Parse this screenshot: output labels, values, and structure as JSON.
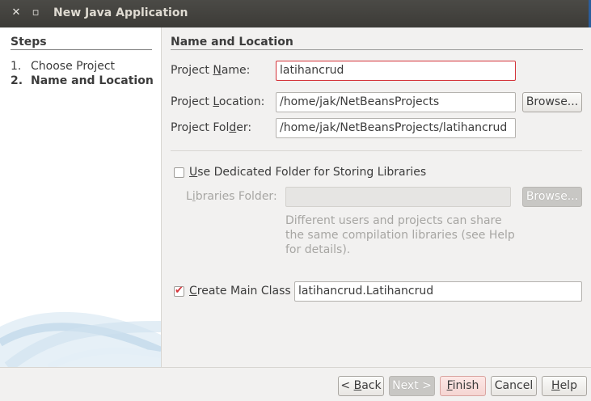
{
  "window": {
    "title": "New Java Application",
    "close_glyph": "✕",
    "minimize_glyph": "▫"
  },
  "steps": {
    "heading": "Steps",
    "items": [
      {
        "num": "1.",
        "label": "Choose Project"
      },
      {
        "num": "2.",
        "label": "Name and Location"
      }
    ]
  },
  "form": {
    "section_heading": "Name and Location",
    "project_name": {
      "label_pre": "Project ",
      "label_key": "N",
      "label_post": "ame:",
      "value": "latihancrud"
    },
    "project_location": {
      "label_pre": "Project ",
      "label_key": "L",
      "label_post": "ocation:",
      "value": "/home/jak/NetBeansProjects",
      "browse_label": "Browse..."
    },
    "project_folder": {
      "label_pre": "Project Fol",
      "label_key": "d",
      "label_post": "er:",
      "value": "/home/jak/NetBeansProjects/latihancrud"
    },
    "dedicated_folder": {
      "label_key": "U",
      "label_post": "se Dedicated Folder for Storing Libraries",
      "checked": false
    },
    "libraries_folder": {
      "label_pre": "L",
      "label_key": "i",
      "label_post": "braries Folder:",
      "value": "",
      "browse_label": "Browse..."
    },
    "description": "Different users and projects can share the same compilation libraries (see Help for details).",
    "create_main_class": {
      "label_key": "C",
      "label_post": "reate Main Class",
      "checked": true,
      "value": "latihancrud.Latihancrud"
    }
  },
  "buttons": {
    "back": {
      "key": "B",
      "post": "ack",
      "pre": "< "
    },
    "next": "Next >",
    "finish": {
      "key": "F",
      "post": "inish"
    },
    "cancel": "Cancel",
    "help": {
      "key": "H",
      "post": "elp"
    }
  }
}
